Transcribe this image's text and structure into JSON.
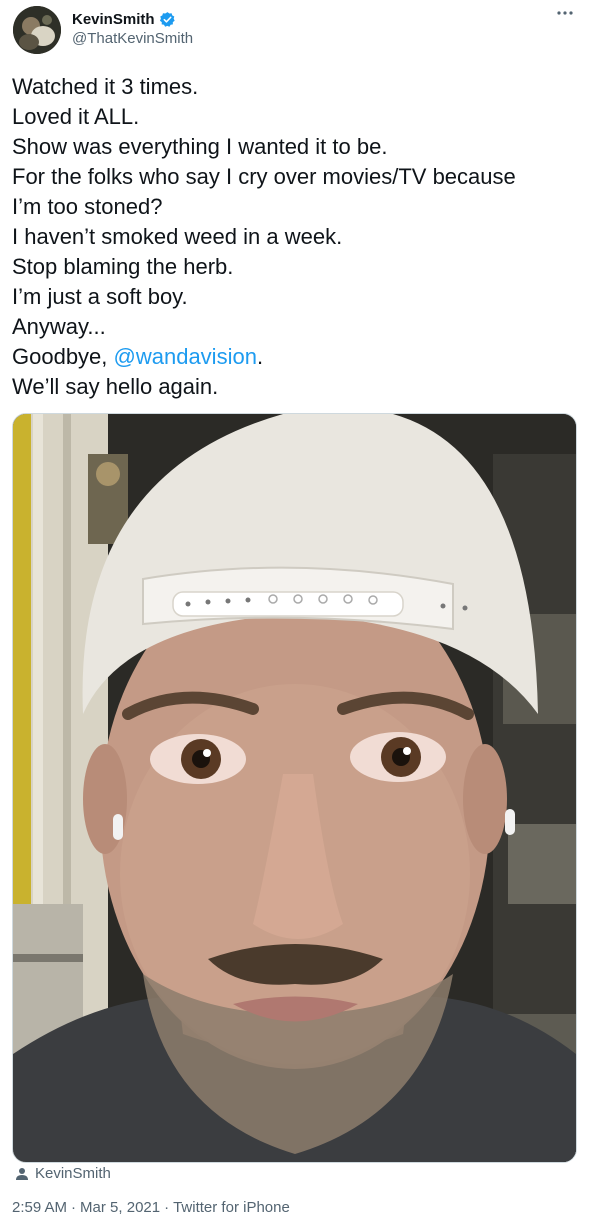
{
  "author": {
    "name": "KevinSmith",
    "handle": "@ThatKevinSmith"
  },
  "tweet": {
    "lines": [
      "Watched it 3 times.",
      "Loved it ALL.",
      "Show was everything I wanted it to be.",
      "For the folks who say I cry over movies/TV because",
      "I’m too stoned?",
      "I haven’t smoked weed in a week.",
      "Stop blaming the herb.",
      "I’m just a soft boy.",
      "Anyway...",
      "Goodbye, ",
      "We’ll say hello again."
    ],
    "mention": "@wandavision",
    "mention_suffix": "."
  },
  "media": {
    "tagged_user": "KevinSmith"
  },
  "meta": {
    "time": "2:59 AM",
    "date": "Mar 5, 2021",
    "source": "Twitter for iPhone",
    "separator": "·"
  },
  "colors": {
    "text": "#0f1419",
    "secondary": "#536471",
    "link": "#1d9bf0",
    "verified": "#1d9bf0"
  }
}
